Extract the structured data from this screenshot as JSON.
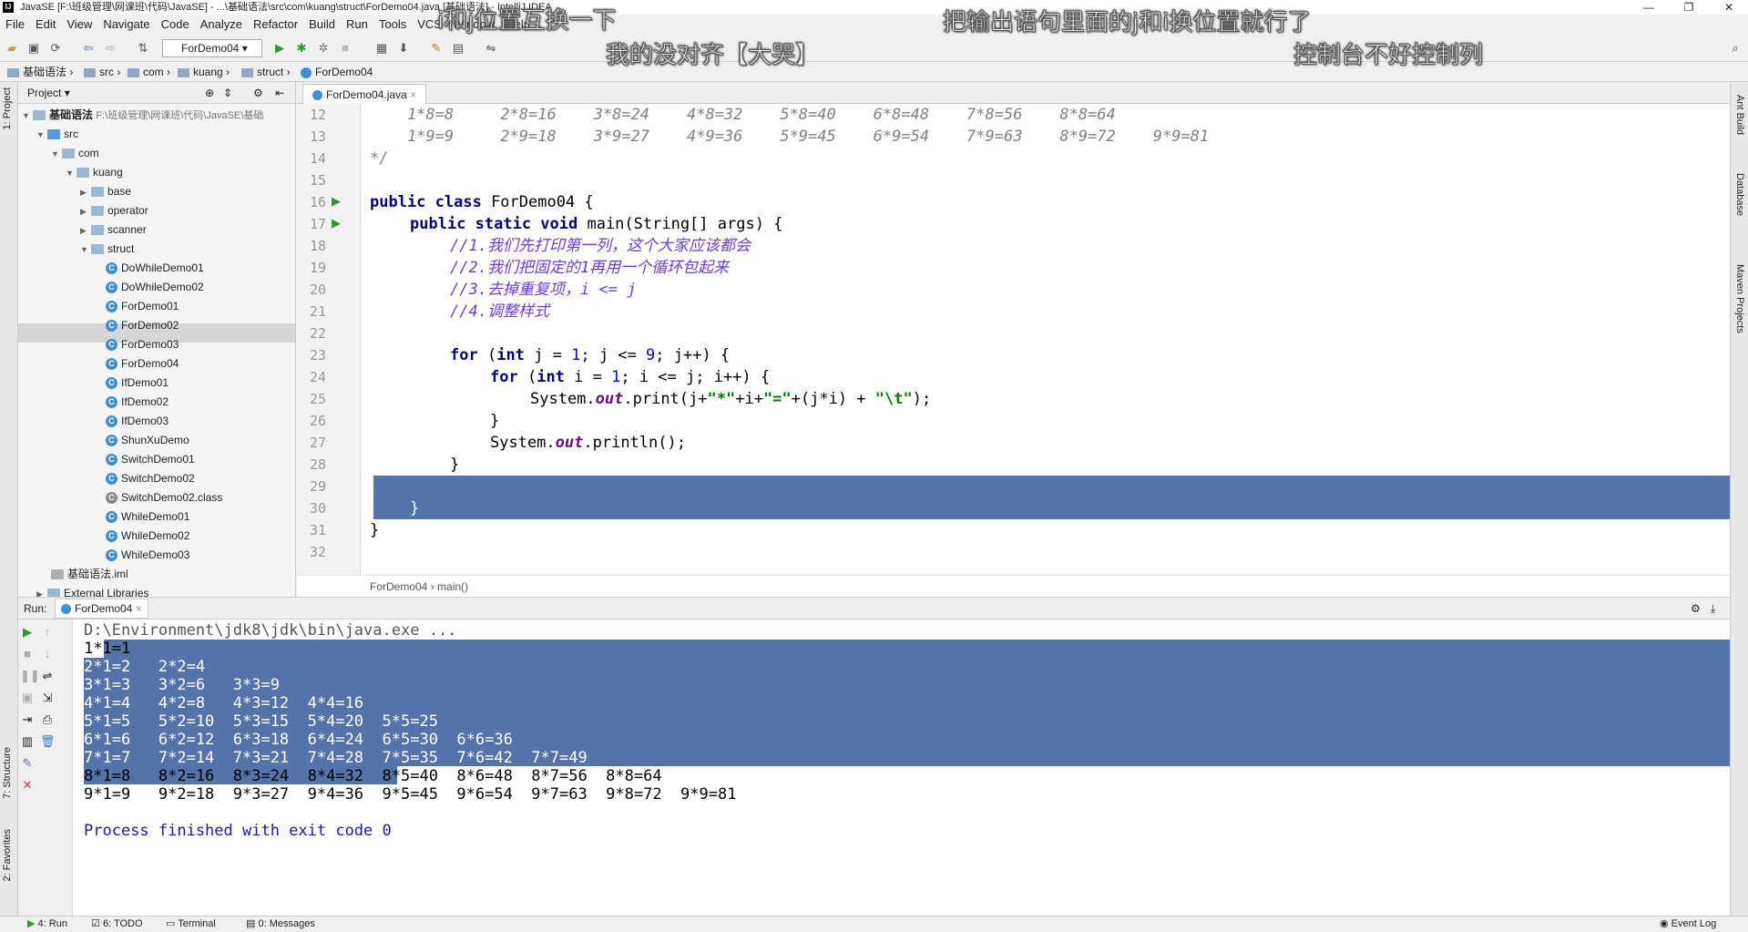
{
  "window": {
    "title": "JavaSE [F:\\班级管理\\网课班\\代码\\JavaSE] - ...\\基础语法\\src\\com\\kuang\\struct\\ForDemo04.java [基础语法] - IntelliJ IDEA",
    "minimize": "—",
    "maximize": "❐",
    "close": "✕"
  },
  "overlays": {
    "top_left": "i和j位置互换一下",
    "top_center": "我的没对齐【大哭】",
    "top_right": "把输出语句里面的j和i换位置就行了",
    "right_2": "控制台不好控制列"
  },
  "menu": [
    "File",
    "Edit",
    "View",
    "Navigate",
    "Code",
    "Analyze",
    "Refactor",
    "Build",
    "Run",
    "Tools",
    "VCS",
    "Window",
    "Help"
  ],
  "toolbar": {
    "run_config": "ForDemo04"
  },
  "breadcrumbs": [
    "基础语法",
    "src",
    "com",
    "kuang",
    "struct",
    "ForDemo04"
  ],
  "left_tabs": {
    "project": "1: Project",
    "structure": "7: Structure",
    "favorites": "2: Favorites"
  },
  "right_tabs": {
    "ant": "Ant Build",
    "database": "Database",
    "maven": "Maven Projects"
  },
  "project": {
    "header": "Project",
    "root": "基础语法",
    "root_path": "F:\\班级管理\\网课班\\代码\\JavaSE\\基础",
    "src": "src",
    "com": "com",
    "kuang": "kuang",
    "folders": [
      "base",
      "operator",
      "scanner",
      "struct"
    ],
    "files": [
      "DoWhileDemo01",
      "DoWhileDemo02",
      "ForDemo01",
      "ForDemo02",
      "ForDemo03",
      "ForDemo04",
      "IfDemo01",
      "IfDemo02",
      "IfDemo03",
      "ShunXuDemo",
      "SwitchDemo01",
      "SwitchDemo02",
      "SwitchDemo02.class",
      "WhileDemo01",
      "WhileDemo02",
      "WhileDemo03"
    ],
    "iml": "基础语法.iml",
    "ext": "External Libraries"
  },
  "editor": {
    "tab": "ForDemo04.java",
    "line_numbers": [
      "12",
      "13",
      "14",
      "15",
      "16",
      "17",
      "18",
      "19",
      "20",
      "21",
      "22",
      "23",
      "24",
      "25",
      "26",
      "27",
      "28",
      "29",
      "30",
      "31",
      "32"
    ],
    "breadcrumb": [
      "ForDemo04",
      "main()"
    ],
    "code": {
      "l12": "    1*8=8     2*8=16    3*8=24    4*8=32    5*8=40    6*8=48    7*8=56    8*8=64",
      "l13": "    1*9=9     2*9=18    3*9=27    4*9=36    5*9=45    6*9=54    7*9=63    8*9=72    9*9=81",
      "l14": "*/",
      "l16_kw": "public class",
      "l16_rest": " ForDemo04 {",
      "l17_kw": "public static void",
      "l17_rest": " main(String[] args) {",
      "l18": "//1.我们先打印第一列，这个大家应该都会",
      "l19": "//2.我们把固定的1再用一个循环包起来",
      "l20": "//3.去掉重复项，i <= j",
      "l21": "//4.调整样式",
      "l23_a": "for",
      "l23_b": " (",
      "l23_c": "int",
      "l23_d": " j = ",
      "l23_e": "1",
      "l23_f": "; j <= ",
      "l23_g": "9",
      "l23_h": "; j++) {",
      "l24_a": "for",
      "l24_b": " (",
      "l24_c": "int",
      "l24_d": " i = ",
      "l24_e": "1",
      "l24_f": "; i <= j; i++) {",
      "l25_a": "System.",
      "l25_b": "out",
      "l25_c": ".print(j+",
      "l25_d": "\"*\"",
      "l25_e": "+i+",
      "l25_f": "\"=\"",
      "l25_g": "+(j*i) + ",
      "l25_h": "\"\\t\"",
      "l25_i": ");",
      "l26": "}",
      "l27_a": "System.",
      "l27_b": "out",
      "l27_c": ".println();",
      "l28": "}",
      "l30": "}",
      "l31": "}"
    }
  },
  "run": {
    "label": "Run:",
    "tab": "ForDemo04",
    "cmd": "D:\\Environment\\jdk8\\jdk\\bin\\java.exe ...",
    "output": [
      "1*1=1",
      "2*1=2   2*2=4",
      "3*1=3   3*2=6   3*3=9",
      "4*1=4   4*2=8   4*3=12  4*4=16",
      "5*1=5   5*2=10  5*3=15  5*4=20  5*5=25",
      "6*1=6   6*2=12  6*3=18  6*4=24  6*5=30  6*6=36",
      "7*1=7   7*2=14  7*3=21  7*4=28  7*5=35  7*6=42  7*7=49",
      "8*1=8   8*2=16  8*3=24  8*4=32  8*5=40  8*6=48  8*7=56  8*8=64",
      "9*1=9   9*2=18  9*3=27  9*4=36  9*5=45  9*6=54  9*7=63  9*8=72  9*9=81"
    ],
    "finished": "Process finished with exit code 0"
  },
  "statusbar": {
    "run": "4: Run",
    "todo": "6: TODO",
    "terminal": "Terminal",
    "messages": "0: Messages",
    "event_log": "Event Log"
  }
}
